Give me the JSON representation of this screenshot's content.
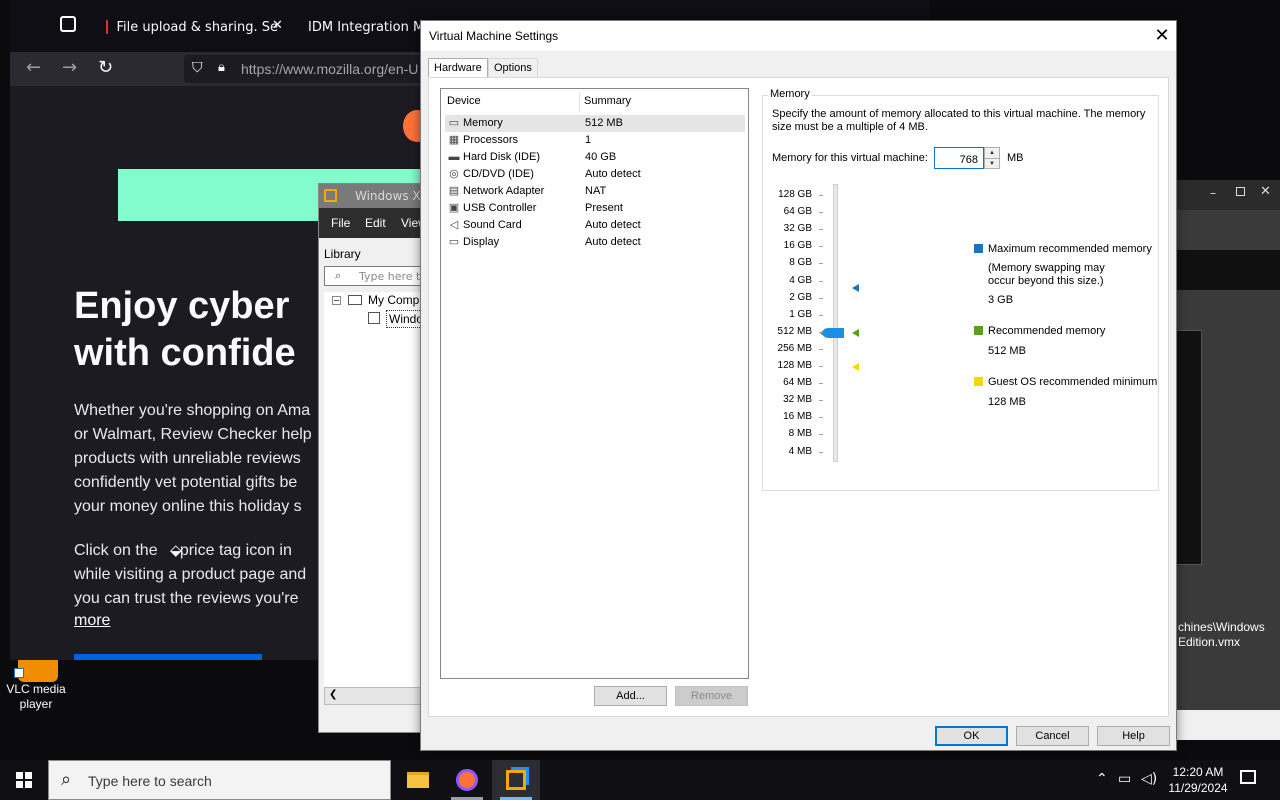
{
  "firefox": {
    "tab1": "File upload & sharing. Se",
    "tab2": "IDM Integration M",
    "url": "https://www.mozilla.org/en-U",
    "heading": "Enjoy cyber\nwith confide",
    "para1": [
      "Whether you're shopping on Ama",
      "or Walmart, Review Checker help",
      "products with unreliable reviews",
      "confidently vet potential gifts be",
      "your money online this holiday s"
    ],
    "para2": [
      "Click on the     price tag icon in",
      "while visiting a product page and",
      "you can trust the reviews you're"
    ],
    "more": "more"
  },
  "vmware_bg": {
    "title": "Windows XP",
    "menu": [
      "File",
      "Edit",
      "View"
    ],
    "library": "Library",
    "search_placeholder": "Type here to",
    "tree": [
      "My Comp",
      "Windo"
    ]
  },
  "right_window": {
    "path": [
      "chines\\Windows",
      "Edition.vmx"
    ]
  },
  "desktop": {
    "vlc_label": "VLC media\nplayer"
  },
  "dialog": {
    "title": "Virtual Machine Settings",
    "tabs": [
      "Hardware",
      "Options"
    ],
    "device_header": "Device",
    "summary_header": "Summary",
    "devices": [
      {
        "name": "Memory",
        "summary": "512 MB",
        "icon": "memory-icon",
        "glyph": "▭"
      },
      {
        "name": "Processors",
        "summary": "1",
        "icon": "processor-icon",
        "glyph": "▦"
      },
      {
        "name": "Hard Disk (IDE)",
        "summary": "40 GB",
        "icon": "hard-disk-icon",
        "glyph": "▬"
      },
      {
        "name": "CD/DVD (IDE)",
        "summary": "Auto detect",
        "icon": "cd-dvd-icon",
        "glyph": "◎"
      },
      {
        "name": "Network Adapter",
        "summary": "NAT",
        "icon": "network-icon",
        "glyph": "▤"
      },
      {
        "name": "USB Controller",
        "summary": "Present",
        "icon": "usb-icon",
        "glyph": "▣"
      },
      {
        "name": "Sound Card",
        "summary": "Auto detect",
        "icon": "speaker-icon",
        "glyph": "◁"
      },
      {
        "name": "Display",
        "summary": "Auto detect",
        "icon": "monitor-icon",
        "glyph": "▭"
      }
    ],
    "add_button": "Add...",
    "remove_button": "Remove",
    "memory": {
      "group_label": "Memory",
      "description": "Specify the amount of memory allocated to this virtual machine. The memory size must be a multiple of 4 MB.",
      "field_label": "Memory for this virtual machine:",
      "value": "768",
      "unit": "MB",
      "scale": [
        "128 GB",
        "64 GB",
        "32 GB",
        "16 GB",
        "8 GB",
        "4 GB",
        "2 GB",
        "1 GB",
        "512 MB",
        "256 MB",
        "128 MB",
        "64 MB",
        "32 MB",
        "16 MB",
        "8 MB",
        "4 MB"
      ],
      "legend": {
        "max_label": "Maximum recommended memory",
        "max_note": "(Memory swapping may\noccur beyond this size.)",
        "max_value": "3 GB",
        "rec_label": "Recommended memory",
        "rec_value": "512 MB",
        "min_label": "Guest OS recommended minimum",
        "min_value": "128 MB"
      },
      "colors": {
        "max": "#1e73be",
        "rec": "#5a9e1e",
        "min": "#f5d800",
        "slider": "#1a8fe3"
      }
    },
    "ok_button": "OK",
    "cancel_button": "Cancel",
    "help_button": "Help"
  },
  "taskbar": {
    "search_placeholder": "Type here to search",
    "time": "12:20 AM",
    "date": "11/29/2024"
  }
}
